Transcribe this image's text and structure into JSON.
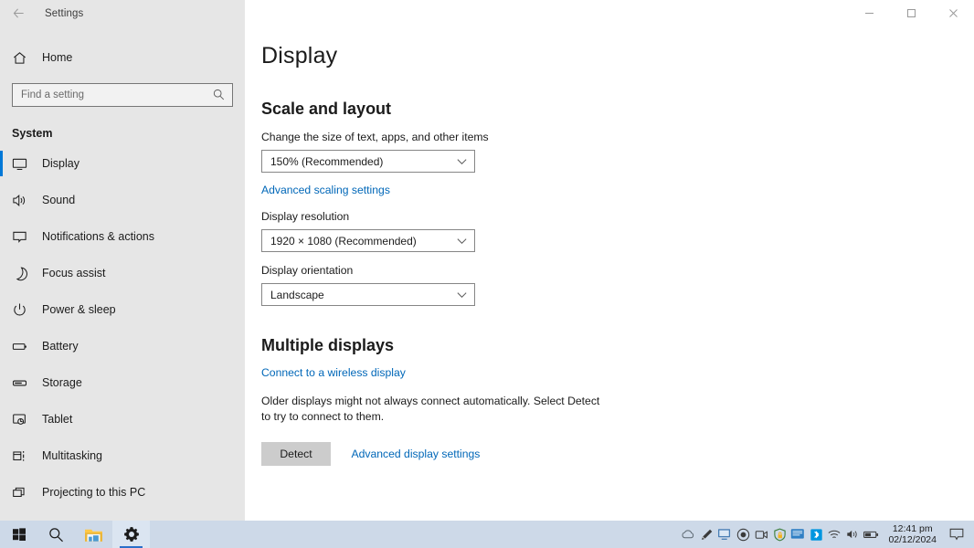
{
  "window": {
    "title": "Settings",
    "back_icon": "back-arrow-icon",
    "controls": [
      {
        "name": "minimize",
        "icon": "minimize-icon"
      },
      {
        "name": "maximize",
        "icon": "maximize-icon"
      },
      {
        "name": "close",
        "icon": "close-icon"
      }
    ]
  },
  "sidebar": {
    "home_label": "Home",
    "home_icon": "home-icon",
    "search": {
      "placeholder": "Find a setting",
      "value": "",
      "icon": "search-icon"
    },
    "group_title": "System",
    "items": [
      {
        "label": "Display",
        "icon": "monitor-icon",
        "selected": true
      },
      {
        "label": "Sound",
        "icon": "speaker-icon",
        "selected": false
      },
      {
        "label": "Notifications & actions",
        "icon": "notification-icon",
        "selected": false
      },
      {
        "label": "Focus assist",
        "icon": "moon-icon",
        "selected": false
      },
      {
        "label": "Power & sleep",
        "icon": "power-icon",
        "selected": false
      },
      {
        "label": "Battery",
        "icon": "battery-icon",
        "selected": false
      },
      {
        "label": "Storage",
        "icon": "storage-icon",
        "selected": false
      },
      {
        "label": "Tablet",
        "icon": "tablet-icon",
        "selected": false
      },
      {
        "label": "Multitasking",
        "icon": "multitasking-icon",
        "selected": false
      },
      {
        "label": "Projecting to this PC",
        "icon": "projecting-icon",
        "selected": false
      }
    ]
  },
  "main": {
    "page_title": "Display",
    "scale_section": {
      "heading": "Scale and layout",
      "scale_label": "Change the size of text, apps, and other items",
      "scale_value": "150% (Recommended)",
      "advanced_scaling_link": "Advanced scaling settings",
      "resolution_label": "Display resolution",
      "resolution_value": "1920 × 1080 (Recommended)",
      "orientation_label": "Display orientation",
      "orientation_value": "Landscape"
    },
    "multiple_displays": {
      "heading": "Multiple displays",
      "wireless_link": "Connect to a wireless display",
      "description": "Older displays might not always connect automatically. Select Detect to try to connect to them.",
      "detect_button": "Detect",
      "advanced_display_link": "Advanced display settings"
    }
  },
  "taskbar": {
    "start_icon": "windows-start-icon",
    "search_icon": "search-icon",
    "buttons": [
      {
        "name": "start-button",
        "icon": "windows-start-icon",
        "active": false
      },
      {
        "name": "taskbar-search-button",
        "icon": "search-icon",
        "active": false
      },
      {
        "name": "file-explorer-button",
        "icon": "folder-icon",
        "active": false
      },
      {
        "name": "settings-taskbar-button",
        "icon": "gear-icon",
        "active": true
      }
    ],
    "tray_icons": [
      "cloud-icon",
      "pen-icon",
      "display-icon",
      "record-icon",
      "camera-icon",
      "security-shield-icon",
      "remote-desktop-icon",
      "bluetooth-icon",
      "wifi-icon",
      "volume-icon",
      "battery-icon"
    ],
    "clock": {
      "time": "12:41 pm",
      "date": "02/12/2024"
    },
    "notification_icon": "action-center-icon"
  },
  "colors": {
    "accent": "#0078d7",
    "link": "#0067b8",
    "sidebar_bg": "#e6e6e6",
    "taskbar_bg": "#cdd9e8",
    "bluetooth": "#0096e0"
  }
}
